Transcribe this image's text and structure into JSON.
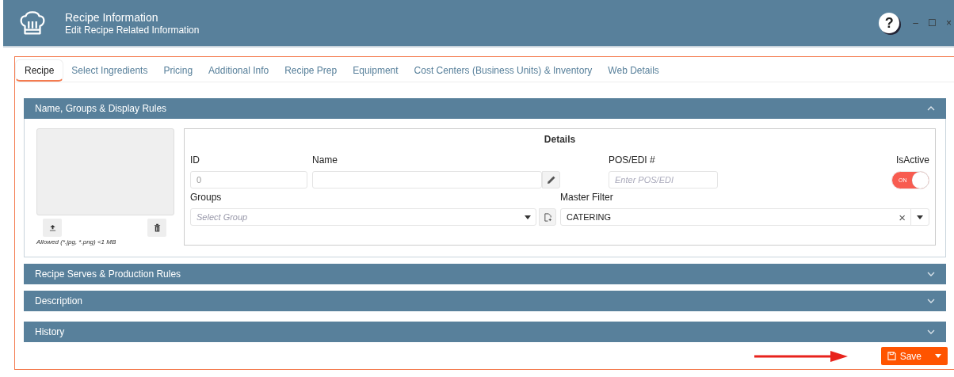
{
  "header": {
    "title": "Recipe Information",
    "subtitle": "Edit Recipe Related Information",
    "help": "?",
    "window_controls": [
      "–",
      "☐",
      "×"
    ]
  },
  "tabs": [
    {
      "label": "Recipe",
      "selected": true
    },
    {
      "label": "Select Ingredients",
      "selected": false
    },
    {
      "label": "Pricing",
      "selected": false
    },
    {
      "label": "Additional Info",
      "selected": false
    },
    {
      "label": "Recipe Prep",
      "selected": false
    },
    {
      "label": "Equipment",
      "selected": false
    },
    {
      "label": "Cost Centers (Business Units) & Inventory",
      "selected": false
    },
    {
      "label": "Web Details",
      "selected": false
    }
  ],
  "sections": [
    {
      "title": "Name, Groups & Display Rules",
      "expanded": true
    },
    {
      "title": "Recipe Serves & Production Rules",
      "expanded": false
    },
    {
      "title": "Description",
      "expanded": false
    },
    {
      "title": "History",
      "expanded": false
    }
  ],
  "image": {
    "hint": "Allowed (*.jpg, *.png) <1 MB"
  },
  "details": {
    "title": "Details",
    "id": {
      "label": "ID",
      "placeholder": "0"
    },
    "name": {
      "label": "Name"
    },
    "pos": {
      "label": "POS/EDI #",
      "placeholder": "Enter POS/EDI"
    },
    "active": {
      "label": "IsActive",
      "on": true,
      "text": "ON"
    },
    "groups": {
      "label": "Groups",
      "placeholder": "Select Group"
    },
    "master_filter": {
      "label": "Master Filter",
      "value": "CATERING",
      "clear": "×"
    }
  },
  "save": {
    "label": "Save"
  }
}
